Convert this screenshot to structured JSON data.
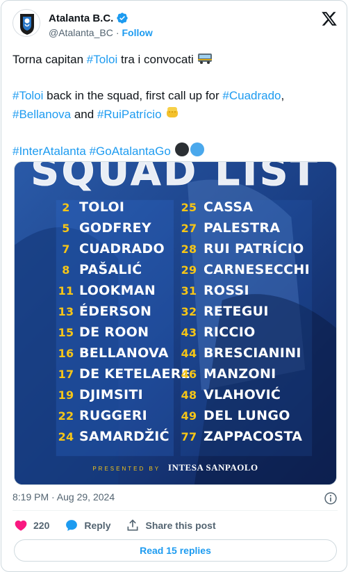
{
  "account": {
    "name": "Atalanta B.C.",
    "handle": "@Atalanta_BC",
    "separator": "·",
    "follow_label": "Follow"
  },
  "tweet": {
    "line1_text": "Torna capitan ",
    "line1_tag": "#Toloi",
    "line1_rest": " tra i convocati ",
    "line2_tag1": "#Toloi",
    "line2_text1": " back in the squad, first call up for ",
    "line2_tag2": "#Cuadrado",
    "line2_comma": ",",
    "line3_tag1": "#Bellanova",
    "line3_text1": " and ",
    "line3_tag2": "#RuiPatrício",
    "line4_tag1": "#InterAtalanta",
    "line4_tag2": "#GoAtalantaGo"
  },
  "media": {
    "title": "SQUAD LIST",
    "left_column": [
      {
        "num": "2",
        "name": "TOLOI"
      },
      {
        "num": "5",
        "name": "GODFREY"
      },
      {
        "num": "7",
        "name": "CUADRADO"
      },
      {
        "num": "8",
        "name": "PAŠALIĆ"
      },
      {
        "num": "11",
        "name": "LOOKMAN"
      },
      {
        "num": "13",
        "name": "ÉDERSON"
      },
      {
        "num": "15",
        "name": "DE ROON"
      },
      {
        "num": "16",
        "name": "BELLANOVA"
      },
      {
        "num": "17",
        "name": "DE KETELAERE"
      },
      {
        "num": "19",
        "name": "DJIMSITI"
      },
      {
        "num": "22",
        "name": "RUGGERI"
      },
      {
        "num": "24",
        "name": "SAMARDŽIĆ"
      }
    ],
    "right_column": [
      {
        "num": "25",
        "name": "CASSA"
      },
      {
        "num": "27",
        "name": "PALESTRA"
      },
      {
        "num": "28",
        "name": "RUI PATRÍCIO"
      },
      {
        "num": "29",
        "name": "CARNESECCHI"
      },
      {
        "num": "31",
        "name": "ROSSI"
      },
      {
        "num": "32",
        "name": "RETEGUI"
      },
      {
        "num": "43",
        "name": "RICCIO"
      },
      {
        "num": "44",
        "name": "BRESCIANINI"
      },
      {
        "num": "46",
        "name": "MANZONI"
      },
      {
        "num": "48",
        "name": "VLAHOVIĆ"
      },
      {
        "num": "49",
        "name": "DEL LUNGO"
      },
      {
        "num": "77",
        "name": "ZAPPACOSTA"
      }
    ],
    "presented_by": "PRESENTED BY",
    "sponsor": "INTESA  SANPAOLO"
  },
  "meta": {
    "timestamp": "8:19 PM · Aug 29, 2024"
  },
  "actions": {
    "like_count": "220",
    "reply_label": "Reply",
    "share_label": "Share this post",
    "read_replies_label": "Read 15 replies"
  },
  "colors": {
    "accent": "#1d9bf0",
    "like": "#f91880",
    "number_yellow": "#f5c518",
    "poster_blue": "#1c3f8a"
  }
}
